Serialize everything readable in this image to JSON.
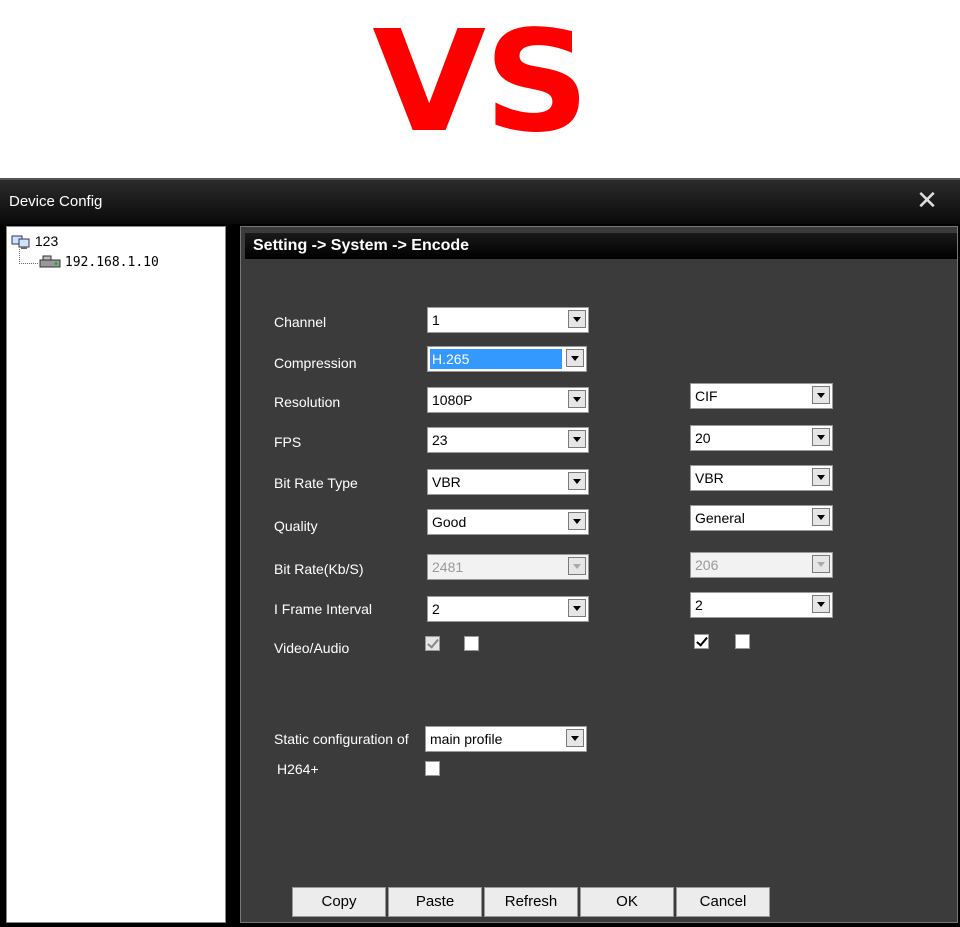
{
  "banner": {
    "text": "VS",
    "color": "#ff0000"
  },
  "window": {
    "title": "Device Config",
    "close_icon": "close-icon"
  },
  "tree": {
    "root": {
      "label": "123",
      "icon": "computer-group-icon"
    },
    "node": {
      "label": "192.168.1.10",
      "icon": "dvr-device-icon"
    }
  },
  "panel": {
    "breadcrumb": "Setting -> System -> Encode",
    "labels": {
      "channel": "Channel",
      "compression": "Compression",
      "resolution": "Resolution",
      "fps": "FPS",
      "bitrate_type": "Bit Rate Type",
      "quality": "Quality",
      "bitrate": "Bit Rate(Kb/S)",
      "iframe": "I Frame Interval",
      "video_audio": "Video/Audio",
      "static_config": "Static configuration of",
      "h264plus": "H264+"
    },
    "main": {
      "channel": "1",
      "compression": "H.265",
      "resolution": "1080P",
      "fps": "23",
      "bitrate_type": "VBR",
      "quality": "Good",
      "bitrate": "2481",
      "iframe": "2",
      "video_checked": true,
      "audio_checked": false
    },
    "extra": {
      "resolution": "CIF",
      "fps": "20",
      "bitrate_type": "VBR",
      "quality": "General",
      "bitrate": "206",
      "iframe": "2",
      "video_checked": true,
      "audio_checked": false
    },
    "static_config_value": "main profile",
    "h264plus_checked": false,
    "buttons": {
      "copy": "Copy",
      "paste": "Paste",
      "refresh": "Refresh",
      "ok": "OK",
      "cancel": "Cancel"
    }
  }
}
